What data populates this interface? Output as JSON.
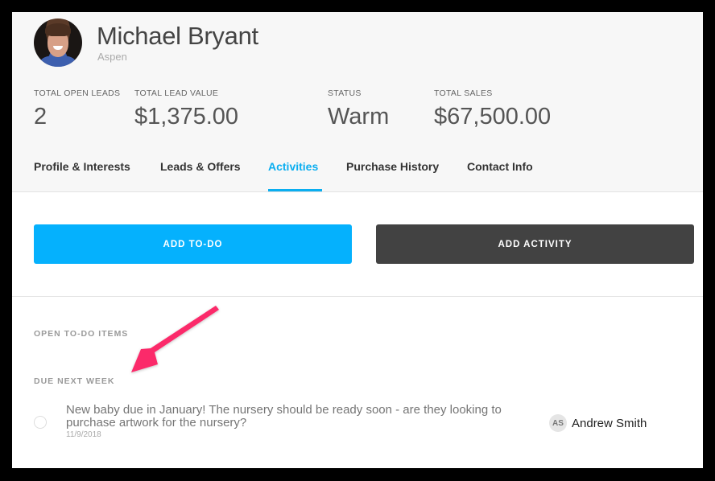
{
  "contact": {
    "name": "Michael Bryant",
    "location": "Aspen",
    "avatar": "contact-photo"
  },
  "stats": [
    {
      "label": "TOTAL OPEN LEADS",
      "value": "2"
    },
    {
      "label": "TOTAL LEAD VALUE",
      "value": "$1,375.00"
    },
    {
      "label": "STATUS",
      "value": "Warm"
    },
    {
      "label": "TOTAL SALES",
      "value": "$67,500.00"
    }
  ],
  "tabs": [
    {
      "label": "Profile & Interests",
      "active": false
    },
    {
      "label": "Leads & Offers",
      "active": false
    },
    {
      "label": "Activities",
      "active": true
    },
    {
      "label": "Purchase History",
      "active": false
    },
    {
      "label": "Contact Info",
      "active": false
    }
  ],
  "actions": {
    "add_todo": "ADD TO-DO",
    "add_activity": "ADD ACTIVITY"
  },
  "todos": {
    "section_title": "OPEN TO-DO ITEMS",
    "group_title": "DUE NEXT WEEK",
    "items": [
      {
        "text": "New baby due in January! The nursery should be ready soon - are they looking to purchase artwork for the nursery?",
        "date": "11/9/2018",
        "assignee_initials": "AS",
        "assignee_name": "Andrew Smith",
        "completed": false
      }
    ]
  },
  "colors": {
    "accent": "#0aaef0",
    "primary_button": "#05b1fd",
    "secondary_button": "#424242",
    "annotation_arrow": "#fb2c6a"
  }
}
